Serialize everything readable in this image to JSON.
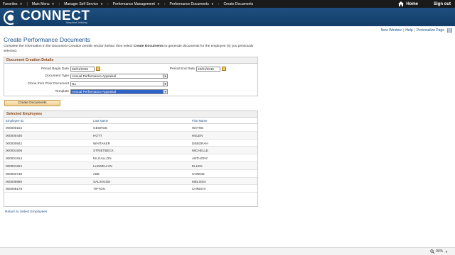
{
  "nav": {
    "items": [
      {
        "label": "Favorites"
      },
      {
        "label": "Main Menu"
      },
      {
        "label": "Manager Self Service"
      },
      {
        "label": "Performance Management"
      },
      {
        "label": "Performance Documents"
      },
      {
        "label": "Create Documents"
      }
    ],
    "home_label": "Home",
    "signout_label": "Sign out"
  },
  "brand": {
    "name": "CONNECT",
    "subtitle": "Maryland Judiciary"
  },
  "util": {
    "new_window": "New Window",
    "help": "Help",
    "personalize": "Personalize Page"
  },
  "page": {
    "title": "Create Performance Documents",
    "instr_part1": "Complete the information in the ",
    "instr_italic": "Document Creation Details",
    "instr_part2": " section below, then select ",
    "instr_bold": "Create Documents",
    "instr_part3": " to generate documents for the employee (s) you previously selected."
  },
  "details": {
    "heading": "Document Creation Details",
    "period_begin_label": "Period Begin Date",
    "period_begin_value": "02/01/2015",
    "period_end_label": "Period End Date",
    "period_end_value": "10/01/2015",
    "doc_type_label": "Document Type",
    "doc_type_value": "Annual Performance Appraisal",
    "clone_label": "Clone from Prior Document",
    "clone_value": "No",
    "template_label": "Template",
    "template_value": "Annual Performance Appraisal"
  },
  "create_button": "Create Documents",
  "employees": {
    "heading": "Selected Employees",
    "columns": [
      "Employee ID",
      "Last Name",
      "First Name"
    ],
    "rows": [
      [
        "000000154",
        "GEORGE",
        "WAYNE"
      ],
      [
        "000000446",
        "HOTT",
        "HELEN"
      ],
      [
        "000000842",
        "WHITAKER",
        "DEBORAH"
      ],
      [
        "000001506",
        "STRIETBECK",
        "MICHELLE"
      ],
      [
        "000001914",
        "KILGALLON",
        "ANTHONY"
      ],
      [
        "000001924",
        "LLEWELLYN",
        "ELLEN"
      ],
      [
        "000003738",
        "ABE",
        "CONNIE"
      ],
      [
        "000005990",
        "SALVAGGE",
        "MELISSA"
      ],
      [
        "000006178",
        "TIPTON",
        "CHRISTA"
      ]
    ]
  },
  "return_link": "Return to Select Employees",
  "status": {
    "zoom": "90%"
  },
  "colors": {
    "nav_bg": "#1a1a1a",
    "header_bg": "#1f4f7f",
    "link": "#1a4f86",
    "section_heading": "#8c4a1c",
    "button_bg": "#f1d08f",
    "selected_field": "#2f63c7"
  },
  "icons": {
    "home": "home-icon",
    "calendar": "calendar-icon",
    "dropdown": "chevron-down-icon",
    "logo": "connect-logo",
    "personalize": "grid-icon",
    "zoom": "magnifier-icon"
  }
}
